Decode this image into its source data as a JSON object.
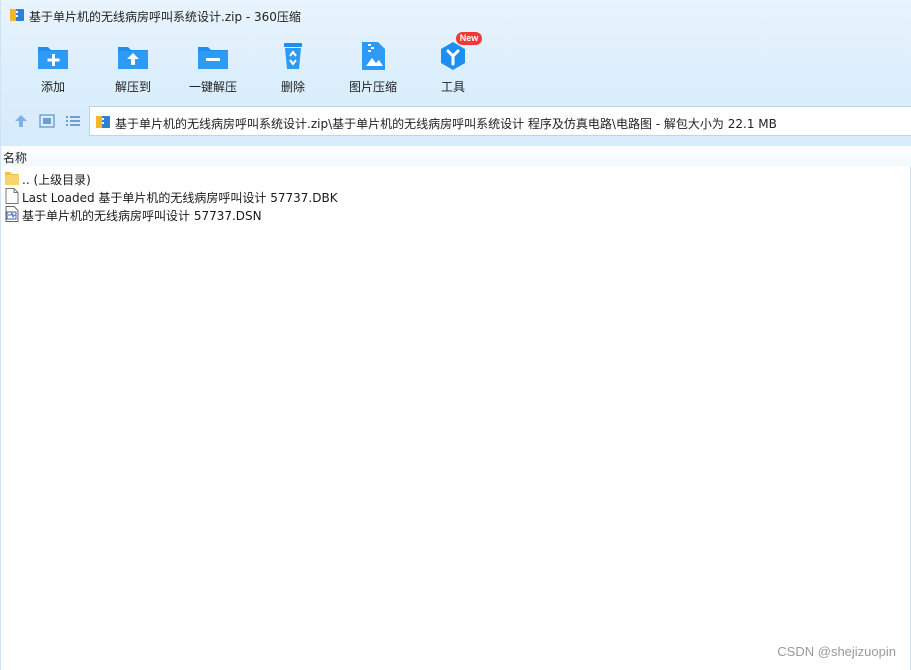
{
  "window": {
    "title": "基于单片机的无线病房呼叫系统设计.zip - 360压缩"
  },
  "toolbar": {
    "add_label": "添加",
    "extract_to_label": "解压到",
    "one_click_extract_label": "一键解压",
    "delete_label": "删除",
    "image_compress_label": "图片压缩",
    "tools_label": "工具",
    "tools_badge": "New"
  },
  "address_bar": {
    "path": "基于单片机的无线病房呼叫系统设计.zip\\基于单片机的无线病房呼叫系统设计 程序及仿真电路\\电路图 - 解包大小为 22.1 MB"
  },
  "file_list": {
    "column_name": "名称",
    "rows": [
      {
        "name": ".. (上级目录)",
        "icon": "folder-icon"
      },
      {
        "name": "Last Loaded 基于单片机的无线病房呼叫设计  57737.DBK",
        "icon": "file-icon"
      },
      {
        "name": "基于单片机的无线病房呼叫设计  57737.DSN",
        "icon": "dsn-file-icon"
      }
    ]
  },
  "watermark": "CSDN @shejizuopin",
  "colors": {
    "toolbar_bg": "#dbeefc",
    "icon_blue": "#1e8ff0",
    "badge_red": "#f03a3a"
  }
}
